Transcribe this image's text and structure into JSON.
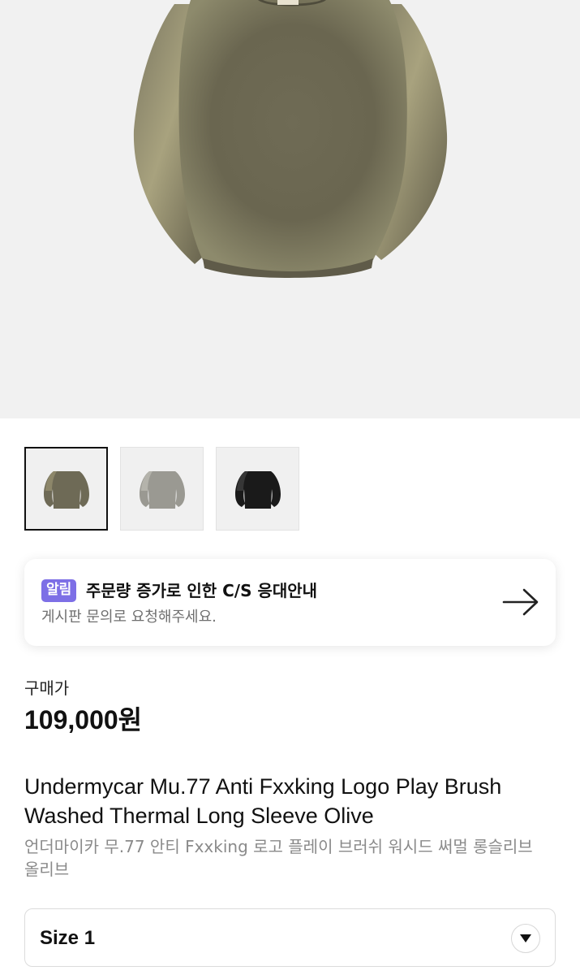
{
  "hero": {
    "image": "product-photo-olive-sweater"
  },
  "thumbnails": [
    {
      "name": "olive",
      "color": "#6e6a56",
      "active": true
    },
    {
      "name": "grey",
      "color": "#9a9992",
      "active": false
    },
    {
      "name": "black",
      "color": "#1a1a1a",
      "active": false
    }
  ],
  "notice": {
    "badge": "알림",
    "title": "주문량 증가로 인한 C/S 응대안내",
    "subtitle": "게시판 문의로 요청해주세요.",
    "icon": "arrow-right-icon"
  },
  "price": {
    "label": "구매가",
    "value": "109,000원"
  },
  "product": {
    "title_en": "Undermycar Mu.77 Anti Fxxking Logo Play Brush Washed Thermal Long Sleeve Olive",
    "title_ko": "언더마이카 무.77 안티 Fxxking 로고 플레이 브러쉬 워시드 써멀 롱슬리브 올리브"
  },
  "size_select": {
    "value": "Size 1",
    "icon": "chevron-down-icon"
  },
  "colors": {
    "badge": "#7d6fe6",
    "olive": "#6e6a56"
  }
}
